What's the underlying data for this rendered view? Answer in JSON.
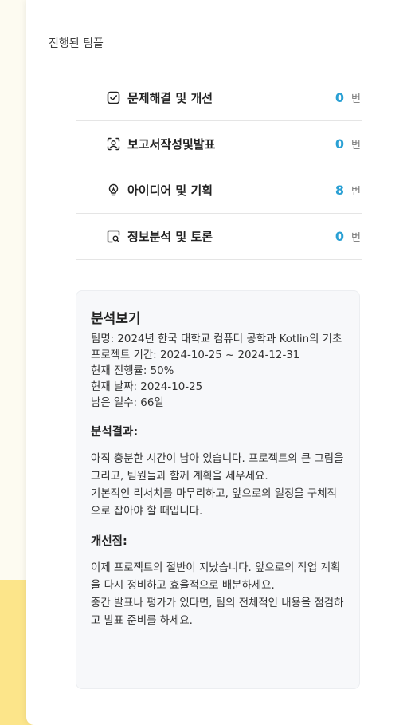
{
  "section_title": "진행된 팀플",
  "stats": [
    {
      "icon": "check-square-icon",
      "label": "문제해결 및 개선",
      "count": "0",
      "unit": "번"
    },
    {
      "icon": "face-scan-icon",
      "label": "보고서작성및발표",
      "count": "0",
      "unit": "번"
    },
    {
      "icon": "lightbulb-icon",
      "label": "아이디어 및 기획",
      "count": "8",
      "unit": "번"
    },
    {
      "icon": "document-search-icon",
      "label": "정보분석 및 토론",
      "count": "0",
      "unit": "번"
    }
  ],
  "analysis": {
    "title": "분석보기",
    "team_name": "팀명: 2024년 한국 대학교 컴퓨터 공학과 Kotlin의 기초",
    "period": "프로젝트 기간: 2024-10-25 ~ 2024-12-31",
    "progress": "현재 진행률: 50%",
    "current_date": "현재 날짜: 2024-10-25",
    "remaining": "남은 일수: 66일",
    "result_heading": "분석결과:",
    "result_text": "아직 충분한 시간이 남아 있습니다. 프로젝트의 큰 그림을 그리고, 팀원들과 함께 계획을 세우세요.",
    "result_text2": "기본적인 리서치를 마무리하고, 앞으로의 일정을 구체적으로 잡아야 할 때입니다.",
    "improve_heading": "개선점:",
    "improve_text": "이제 프로젝트의 절반이 지났습니다. 앞으로의 작업 계획을 다시 정비하고 효율적으로 배분하세요.",
    "improve_text2": "중간 발표나 평가가 있다면, 팀의 전체적인 내용을 점검하고 발표 준비를 하세요."
  }
}
